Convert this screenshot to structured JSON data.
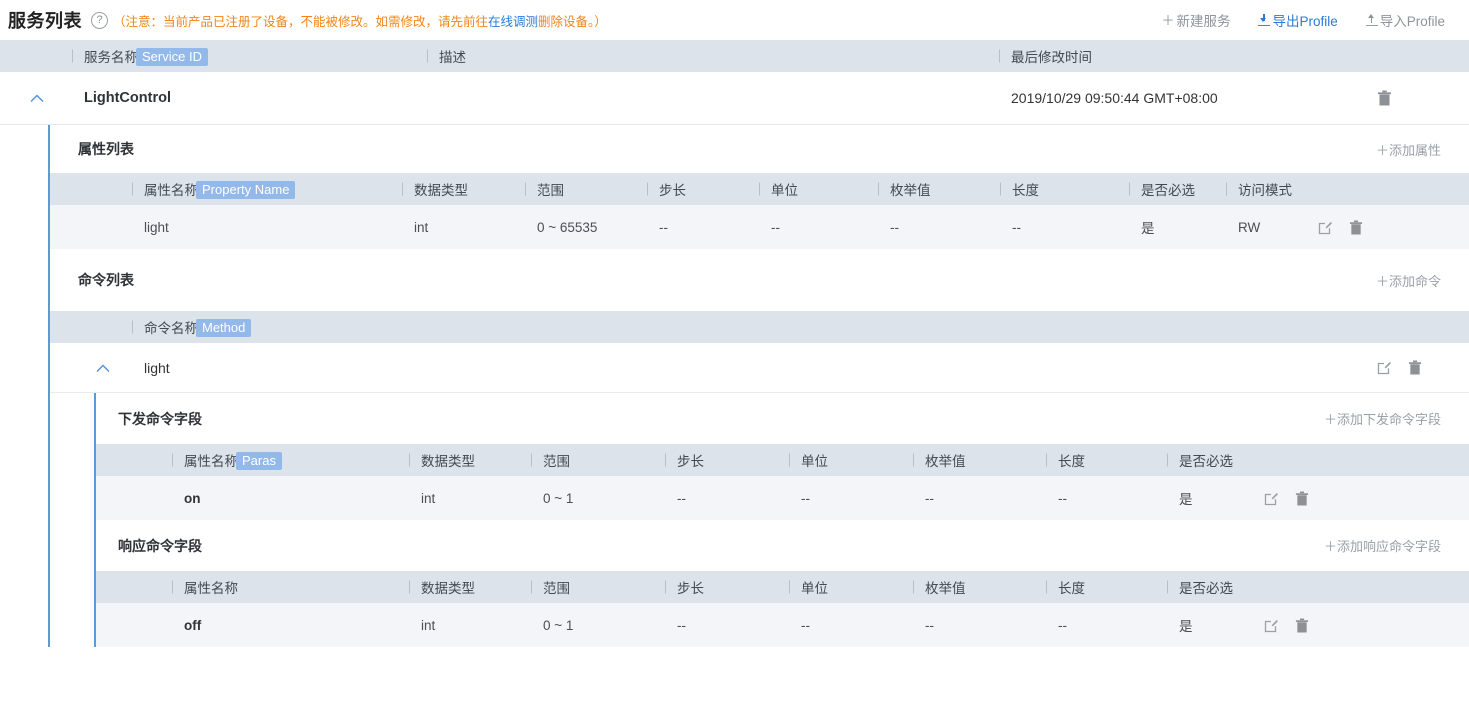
{
  "header": {
    "title": "服务列表",
    "help_icon": "question-circle-icon",
    "note_prefix": "（注意：当前产品已注册了设备，不能被修改。如需修改，请先前往",
    "note_link": "在线调测",
    "note_suffix": "删除设备。）",
    "actions": [
      {
        "label": "新建服务",
        "icon": "plus-icon",
        "plus": "＋",
        "accent": "#8e949c"
      },
      {
        "label": "导出Profile",
        "icon": "download-icon",
        "accent": "#2a7bd4"
      },
      {
        "label": "导入Profile",
        "icon": "upload-icon",
        "accent": "#8e949c"
      }
    ]
  },
  "service_table": {
    "columns": [
      "服务名称",
      "描述",
      "最后修改时间"
    ],
    "name_badge": "Service ID",
    "row": {
      "collapse_icon": "chevron-up-icon",
      "name": "LightControl",
      "description": "",
      "last_modified": "2019/10/29 09:50:44 GMT+08:00",
      "delete_icon": "trash-icon"
    }
  },
  "property_section": {
    "title": "属性列表",
    "add_label": "＋添加属性",
    "columns": [
      "属性名称",
      "数据类型",
      "范围",
      "步长",
      "单位",
      "枚举值",
      "长度",
      "是否必选",
      "访问模式"
    ],
    "name_badge": "Property Name",
    "rows": [
      {
        "name": "light",
        "data_type": "int",
        "range": "0 ~ 65535",
        "step": "--",
        "unit": "--",
        "enum": "--",
        "length": "--",
        "required": "是",
        "access": "RW",
        "edit_icon": "edit-icon",
        "delete_icon": "trash-icon"
      }
    ]
  },
  "command_section": {
    "title": "命令列表",
    "add_label": "＋添加命令",
    "columns": [
      "命令名称"
    ],
    "name_badge": "Method",
    "rows": [
      {
        "collapse_icon": "chevron-up-icon",
        "name": "light",
        "edit_icon": "edit-icon",
        "delete_icon": "trash-icon"
      }
    ]
  },
  "request_section": {
    "title": "下发命令字段",
    "add_label": "＋添加下发命令字段",
    "columns": [
      "属性名称",
      "数据类型",
      "范围",
      "步长",
      "单位",
      "枚举值",
      "长度",
      "是否必选"
    ],
    "name_badge": "Paras",
    "rows": [
      {
        "name": "on",
        "data_type": "int",
        "range": "0 ~ 1",
        "step": "--",
        "unit": "--",
        "enum": "--",
        "length": "--",
        "required": "是",
        "edit_icon": "edit-icon",
        "delete_icon": "trash-icon"
      }
    ]
  },
  "response_section": {
    "title": "响应命令字段",
    "add_label": "＋添加响应命令字段",
    "columns": [
      "属性名称",
      "数据类型",
      "范围",
      "步长",
      "单位",
      "枚举值",
      "长度",
      "是否必选"
    ],
    "name_badge": "",
    "rows": [
      {
        "name": "off",
        "data_type": "int",
        "range": "0 ~ 1",
        "step": "--",
        "unit": "--",
        "enum": "--",
        "length": "--",
        "required": "是",
        "edit_icon": "edit-icon",
        "delete_icon": "trash-icon"
      }
    ]
  },
  "colors": {
    "accent_blue": "#2a7bd4",
    "rail_blue": "#5b9bd5",
    "badge_blue": "#93b8ea",
    "header_bg": "#dde3ea",
    "row_alt_bg": "#f4f5f8",
    "note_orange": "#f08519"
  }
}
